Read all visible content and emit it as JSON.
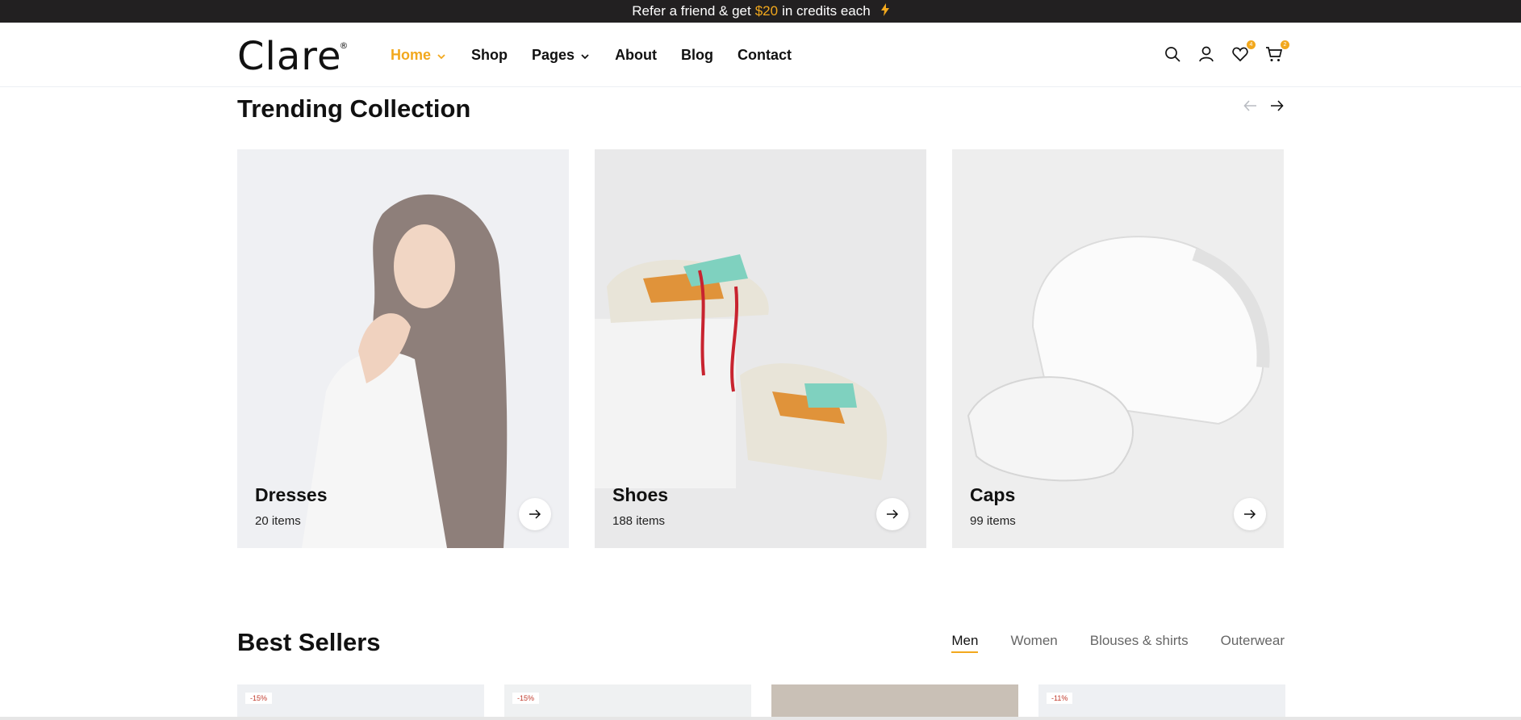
{
  "announcement": {
    "prefix": "Refer a friend & get",
    "amount": "$20",
    "suffix": "in credits each",
    "icon": "bolt-icon"
  },
  "header": {
    "logo": "Clare",
    "logo_mark": "®",
    "nav": [
      {
        "label": "Home",
        "active": true,
        "dropdown": true
      },
      {
        "label": "Shop",
        "active": false,
        "dropdown": false
      },
      {
        "label": "Pages",
        "active": false,
        "dropdown": true
      },
      {
        "label": "About",
        "active": false,
        "dropdown": false
      },
      {
        "label": "Blog",
        "active": false,
        "dropdown": false
      },
      {
        "label": "Contact",
        "active": false,
        "dropdown": false
      }
    ],
    "icons": {
      "search": "search-icon",
      "account": "user-icon",
      "wishlist": "heart-icon",
      "wishlist_count": "4",
      "cart": "cart-icon",
      "cart_count": "2"
    }
  },
  "trending": {
    "title": "Trending Collection",
    "cards": [
      {
        "name": "Dresses",
        "count": "20 items"
      },
      {
        "name": "Shoes",
        "count": "188 items"
      },
      {
        "name": "Caps",
        "count": "99 items"
      }
    ]
  },
  "best_sellers": {
    "title": "Best Sellers",
    "tabs": [
      "Men",
      "Women",
      "Blouses & shirts",
      "Outerwear"
    ],
    "active_tab": "Men",
    "products": [
      {
        "discount": "-15%"
      },
      {
        "discount": "-15%"
      },
      {
        "discount": ""
      },
      {
        "discount": "-11%"
      }
    ]
  },
  "colors": {
    "accent": "#f2a81d",
    "topbar": "#222021"
  }
}
